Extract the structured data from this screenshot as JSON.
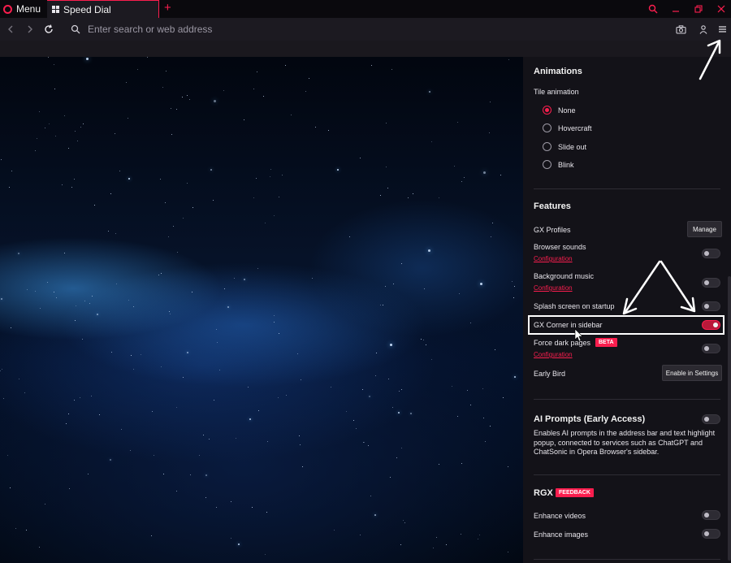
{
  "browser": {
    "menu_label": "Menu",
    "tab_title": "Speed Dial",
    "new_tab_symbol": "+",
    "accent_color": "#fa1e4e",
    "search_placeholder": "Enter search or web address"
  },
  "icons": {
    "opera": "opera-logo-icon",
    "speed_dial": "grid-icon",
    "back": "chevron-left-icon",
    "forward": "chevron-right-icon",
    "reload": "reload-icon",
    "search": "search-icon",
    "snapshot": "camera-icon",
    "account": "person-icon",
    "easy_setup": "hamburger-menu-icon",
    "window_search": "search-icon",
    "minimize": "minimize-icon",
    "restore": "restore-icon",
    "close": "close-icon"
  },
  "settings": {
    "animations": {
      "title": "Animations",
      "tile_animation_label": "Tile animation",
      "options": [
        "None",
        "Hovercraft",
        "Slide out",
        "Blink"
      ],
      "selected": "None"
    },
    "features": {
      "title": "Features",
      "gx_profiles": {
        "label": "GX Profiles",
        "button": "Manage"
      },
      "browser_sounds": {
        "label": "Browser sounds",
        "link": "Configuration",
        "enabled": false
      },
      "background_music": {
        "label": "Background music",
        "link": "Configuration",
        "enabled": false
      },
      "splash_screen": {
        "label": "Splash screen on startup",
        "enabled": false
      },
      "gx_corner": {
        "label": "GX Corner in sidebar",
        "enabled": true
      },
      "force_dark": {
        "label": "Force dark pages",
        "badge": "BETA",
        "link": "Configuration",
        "enabled": false
      },
      "early_bird": {
        "label": "Early Bird",
        "button": "Enable in Settings"
      }
    },
    "ai_prompts": {
      "title": "AI Prompts (Early Access)",
      "description": "Enables AI prompts in the address bar and text highlight popup, connected to services such as ChatGPT and ChatSonic in Opera Browser's sidebar.",
      "enabled": false
    },
    "rgx": {
      "title": "RGX",
      "badge": "FEEDBACK",
      "enhance_videos": {
        "label": "Enhance videos",
        "enabled": false
      },
      "enhance_images": {
        "label": "Enhance images",
        "enabled": false
      }
    }
  }
}
